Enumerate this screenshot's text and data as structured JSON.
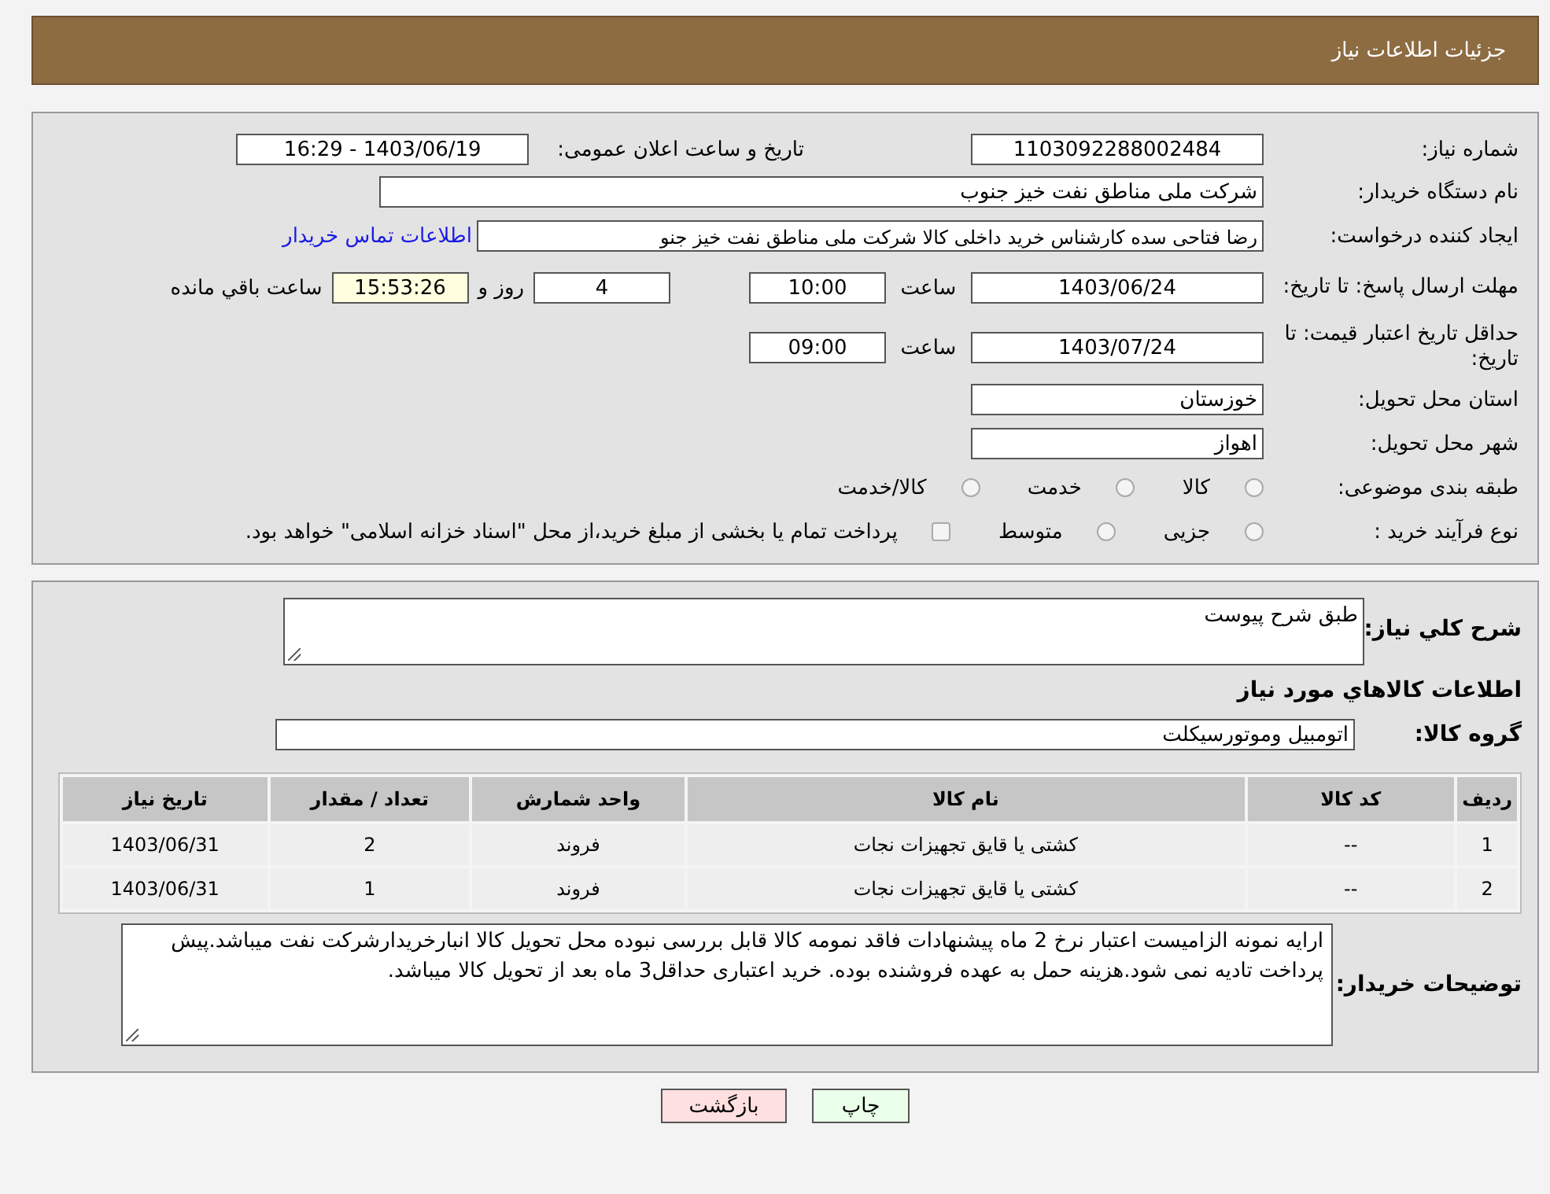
{
  "header": {
    "title": "جزئیات اطلاعات نیاز"
  },
  "need_number": {
    "label": "شماره نیاز:",
    "value": "1103092288002484"
  },
  "announce": {
    "label": "تاریخ و ساعت اعلان عمومی:",
    "value": "1403/06/19 - 16:29"
  },
  "buyer": {
    "label": "نام دستگاه خریدار:",
    "value": "شرکت ملی مناطق نفت خیز جنوب"
  },
  "creator": {
    "label": "ایجاد کننده درخواست:",
    "value": "رضا فتاحی سده  کارشناس خرید داخلی کالا  شرکت ملی مناطق نفت خیز جنو",
    "link": "اطلاعات تماس خریدار"
  },
  "deadline": {
    "label": "مهلت ارسال پاسخ: تا تاریخ:",
    "date": "1403/06/24",
    "time_label": "ساعت",
    "time": "10:00",
    "days": "4",
    "days_label": "روز و",
    "remaining": "15:53:26",
    "remaining_label": "ساعت باقي مانده"
  },
  "validity": {
    "label": "حداقل تاریخ اعتبار قیمت: تا تاریخ:",
    "date": "1403/07/24",
    "time_label": "ساعت",
    "time": "09:00"
  },
  "province": {
    "label": "استان محل تحویل:",
    "value": "خوزستان"
  },
  "city": {
    "label": "شهر محل تحویل:",
    "value": "اهواز"
  },
  "category": {
    "label": "طبقه بندی موضوعی:",
    "options": [
      {
        "label": "کالا",
        "selected": false
      },
      {
        "label": "خدمت",
        "selected": false
      },
      {
        "label": "کالا/خدمت",
        "selected": false
      }
    ]
  },
  "purchase_type": {
    "label": "نوع فرآیند خرید :",
    "options": [
      {
        "label": "جزیی",
        "selected": false
      },
      {
        "label": "متوسط",
        "selected": false
      }
    ],
    "payment": {
      "label": "پرداخت تمام یا بخشی از مبلغ خرید،از محل \"اسناد خزانه اسلامی\" خواهد بود.",
      "checked": false
    }
  },
  "description": {
    "label": "شرح کلي نياز:",
    "value": "طبق شرح پیوست"
  },
  "goods_heading": "اطلاعات کالاهاي مورد نياز",
  "goods_group": {
    "label": "گروه کالا:",
    "value": "اتومبیل وموتورسیکلت"
  },
  "table": {
    "columns": [
      "ردیف",
      "کد کالا",
      "نام کالا",
      "واحد شمارش",
      "تعداد / مقدار",
      "تاریخ نیاز"
    ],
    "rows": [
      [
        "1",
        "--",
        "کشتی یا قایق تجهیزات نجات",
        "فروند",
        "2",
        "1403/06/31"
      ],
      [
        "2",
        "--",
        "کشتی یا قایق تجهیزات نجات",
        "فروند",
        "1",
        "1403/06/31"
      ]
    ]
  },
  "notes": {
    "label": "توضیحات خریدار:",
    "value": "ارایه نمونه الزامیست اعتبار نرخ 2 ماه پیشنهادات فاقد نمومه کالا قابل بررسی نبوده محل تحویل کالا انبارخریدارشرکت نفت میباشد.پیش پرداخت تادیه نمی شود.هزینه حمل به عهده فروشنده بوده. خرید اعتباری حداقل3 ماه بعد از تحویل کالا میباشد."
  },
  "buttons": [
    {
      "label": "چاپ",
      "kind": "print"
    },
    {
      "label": "بازگشت",
      "kind": "back"
    }
  ]
}
